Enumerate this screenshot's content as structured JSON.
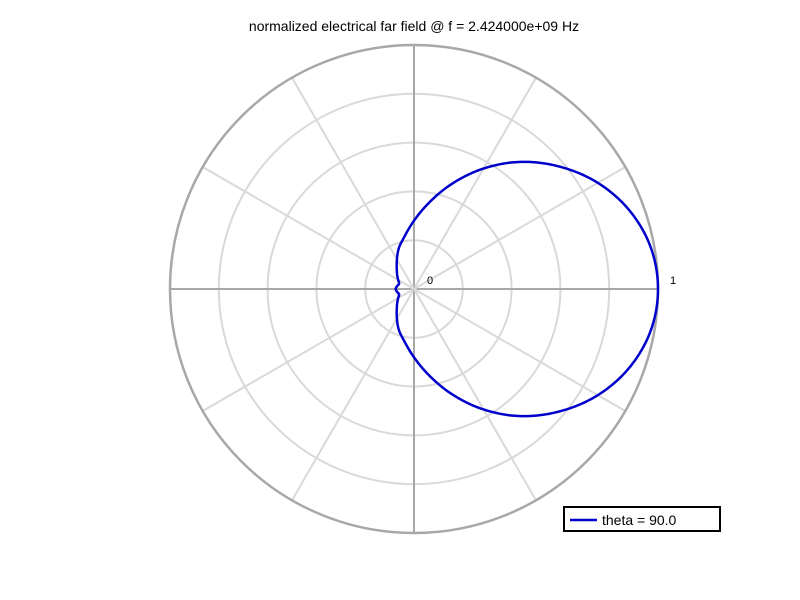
{
  "chart_data": {
    "type": "line",
    "subtype": "polar",
    "title": "normalized electrical far field @ f = 2.424000e+09 Hz",
    "radial_labels": [
      "0",
      "1"
    ],
    "rlim": [
      0,
      1
    ],
    "angle_units": "degrees",
    "grid": true,
    "legend_position": "bottom-right",
    "series": [
      {
        "name": "theta = 90.0",
        "color": "#0000cc",
        "phi": [
          0,
          10,
          20,
          30,
          40,
          50,
          60,
          70,
          80,
          90,
          100,
          110,
          120,
          130,
          140,
          150,
          160,
          170,
          180,
          190,
          200,
          210,
          220,
          230,
          240,
          250,
          260,
          270,
          280,
          290,
          300,
          310,
          320,
          330,
          340,
          350
        ],
        "values": [
          1.0,
          0.985,
          0.94,
          0.87,
          0.78,
          0.68,
          0.57,
          0.46,
          0.36,
          0.28,
          0.22,
          0.18,
          0.14,
          0.11,
          0.09,
          0.075,
          0.065,
          0.07,
          0.075,
          0.07,
          0.065,
          0.075,
          0.09,
          0.11,
          0.14,
          0.18,
          0.22,
          0.28,
          0.36,
          0.46,
          0.57,
          0.68,
          0.78,
          0.87,
          0.94,
          0.985
        ]
      }
    ]
  }
}
